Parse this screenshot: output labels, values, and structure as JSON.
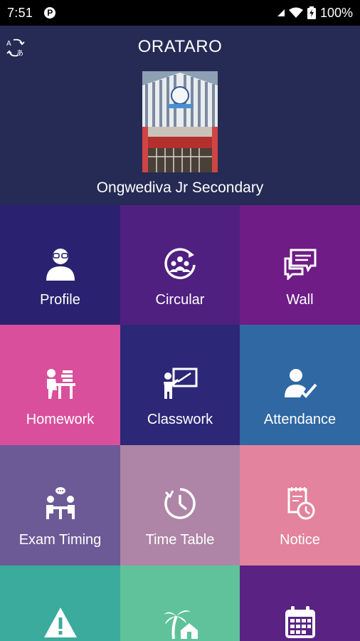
{
  "status": {
    "time": "7:51",
    "battery": "100%"
  },
  "header": {
    "title": "ORATARO",
    "school_name": "Ongwediva Jr Secondary"
  },
  "tiles": [
    {
      "label": "Profile",
      "color": "#2a2270",
      "icon": "person-avatar-icon"
    },
    {
      "label": "Circular",
      "color": "#4f2080",
      "icon": "group-cycle-icon"
    },
    {
      "label": "Wall",
      "color": "#6f1c86",
      "icon": "chat-bubbles-icon"
    },
    {
      "label": "Homework",
      "color": "#d94f9c",
      "icon": "student-desk-icon"
    },
    {
      "label": "Classwork",
      "color": "#2d2777",
      "icon": "teacher-board-icon"
    },
    {
      "label": "Attendance",
      "color": "#2f68a3",
      "icon": "user-check-icon"
    },
    {
      "label": "Exam Timing",
      "color": "#6c5a97",
      "icon": "exam-table-icon"
    },
    {
      "label": "Time Table",
      "color": "#ae85a6",
      "icon": "clock-icon"
    },
    {
      "label": "Notice",
      "color": "#e3839e",
      "icon": "notepad-clock-icon"
    },
    {
      "label": "",
      "color": "#3aab9c",
      "icon": "warning-icon"
    },
    {
      "label": "",
      "color": "#5fc29b",
      "icon": "holiday-palm-icon"
    },
    {
      "label": "",
      "color": "#5a2283",
      "icon": "calendar-icon"
    }
  ]
}
